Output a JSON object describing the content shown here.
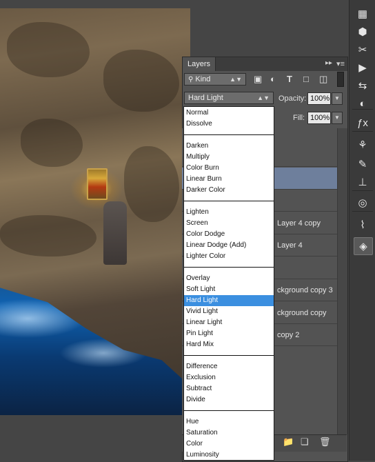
{
  "panel": {
    "tab_label": "Layers",
    "collapse_icon": "double-chevron-right-icon",
    "menu_icon": "panel-menu-icon"
  },
  "filter": {
    "kind_value": "Kind",
    "icons": [
      "image-filter-icon",
      "adjustment-filter-icon",
      "type-filter-icon",
      "shape-filter-icon",
      "smart-object-filter-icon"
    ]
  },
  "blend": {
    "current_value": "Hard Light",
    "opacity_label": "Opacity:",
    "opacity_value": "100%",
    "fill_label": "Fill:",
    "fill_value": "100%",
    "groups": [
      [
        "Normal",
        "Dissolve"
      ],
      [
        "Darken",
        "Multiply",
        "Color Burn",
        "Linear Burn",
        "Darker Color"
      ],
      [
        "Lighten",
        "Screen",
        "Color Dodge",
        "Linear Dodge (Add)",
        "Lighter Color"
      ],
      [
        "Overlay",
        "Soft Light",
        "Hard Light",
        "Vivid Light",
        "Linear Light",
        "Pin Light",
        "Hard Mix"
      ],
      [
        "Difference",
        "Exclusion",
        "Subtract",
        "Divide"
      ],
      [
        "Hue",
        "Saturation",
        "Color",
        "Luminosity"
      ]
    ]
  },
  "layers": [
    {
      "name": ""
    },
    {
      "name": "",
      "selected": true
    },
    {
      "name": ""
    },
    {
      "name": "Layer 4 copy"
    },
    {
      "name": "Layer 4"
    },
    {
      "name": ""
    },
    {
      "name": "ckground copy 3"
    },
    {
      "name": "ckground copy"
    },
    {
      "name": "copy 2"
    }
  ],
  "footer_icons": [
    "new-group-icon",
    "new-layer-icon",
    "delete-layer-icon"
  ],
  "tool_strip": [
    "grid-panel-icon",
    "cube-panel-icon",
    "tools-panel-icon",
    "play-actions-icon",
    "swap-icon",
    "circle-mask-icon",
    "fx-icon",
    "brush-presets-icon",
    "brush-tool-icon",
    "stamp-icon",
    "channels-icon",
    "paths-icon",
    "layers-icon"
  ],
  "colors": {
    "selection_blue": "#3b8fe0",
    "selected_layer": "#6e7f9c",
    "panel_bg": "#535353"
  }
}
